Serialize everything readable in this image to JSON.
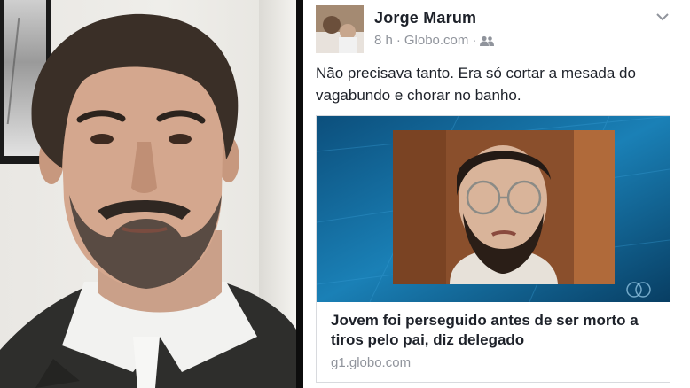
{
  "post": {
    "author": "Jorge Marum",
    "time": "8 h",
    "separator": "·",
    "source": "Globo.com",
    "audience_icon": "friends-icon",
    "menu_icon": "chevron-down-icon",
    "text": "Não precisava tanto. Era só cortar a mesada do vagabundo e chorar no banho.",
    "link": {
      "title": "Jovem foi perseguido antes de ser morto a tiros pelo pai, diz delegado",
      "domain": "g1.globo.com"
    }
  },
  "colors": {
    "text_primary": "#1d2129",
    "text_secondary": "#90949c",
    "news_blue": "#1775a8",
    "background": "#0d0d0d"
  }
}
